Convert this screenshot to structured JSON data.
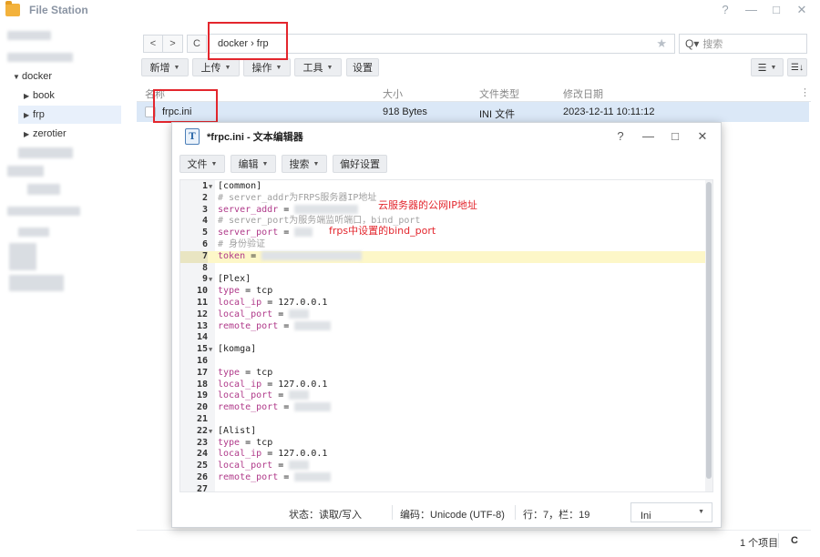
{
  "file_station": {
    "title": "File Station",
    "window_controls": {
      "help": "?",
      "minimize": "—",
      "maximize": "□",
      "close": "✕"
    },
    "sidebar": {
      "tree": [
        {
          "label": "docker",
          "expanded": true
        },
        {
          "label": "book",
          "expanded": false
        },
        {
          "label": "frp",
          "expanded": false,
          "selected": true
        },
        {
          "label": "zerotier",
          "expanded": false
        }
      ]
    },
    "nav": {
      "back": "<",
      "forward": ">",
      "refresh": "C"
    },
    "path": "docker › frp",
    "search": {
      "placeholder": "搜索"
    },
    "toolbar": {
      "new": "新增",
      "upload": "上传",
      "action": "操作",
      "tools": "工具",
      "settings": "设置"
    },
    "columns": {
      "name": "名称",
      "size": "大小",
      "type": "文件类型",
      "modified": "修改日期"
    },
    "files": [
      {
        "name": "frpc.ini",
        "size": "918 Bytes",
        "type": "INI 文件",
        "modified": "2023-12-11 10:11:12"
      }
    ],
    "status": {
      "count": "1 个项目",
      "refresh": "C"
    }
  },
  "editor": {
    "title": "*frpc.ini - 文本编辑器",
    "icon_letter": "T",
    "window_controls": {
      "help": "?",
      "minimize": "—",
      "maximize": "□",
      "close": "✕"
    },
    "menu": {
      "file": "文件",
      "edit": "编辑",
      "search": "搜索",
      "preferences": "偏好设置"
    },
    "lines": [
      "[common]",
      "# server_addr为FRPS服务器IP地址",
      "server_addr = ",
      "# server_port为服务端监听端口，bind_port",
      "server_port = ",
      "# 身份验证",
      "token = ",
      "",
      "[Plex]",
      "type = tcp",
      "local_ip = 127.0.0.1",
      "local_port = ",
      "remote_port = ",
      "",
      "[komga]",
      "",
      "type = tcp",
      "local_ip = 127.0.0.1",
      "local_port = ",
      "remote_port = ",
      "",
      "[Alist]",
      "type = tcp",
      "local_ip = 127.0.0.1",
      "local_port = ",
      "remote_port = ",
      ""
    ],
    "active_line": 7,
    "annotations": {
      "server_addr": "云服务器的公网IP地址",
      "server_port": "frps中设置的bind_port"
    },
    "status": {
      "mode": "状态：读取/写入",
      "encoding": "编码：Unicode (UTF-8)",
      "position": "行：7，栏：19",
      "language": "Ini"
    }
  }
}
